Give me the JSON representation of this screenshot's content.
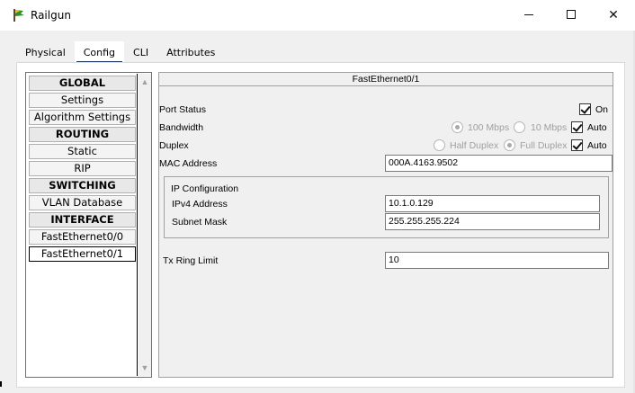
{
  "window": {
    "title": "Railgun",
    "minimize_glyph": "",
    "maximize_glyph": "",
    "close_glyph": "✕"
  },
  "tabs": [
    {
      "label": "Physical"
    },
    {
      "label": "Config"
    },
    {
      "label": "CLI"
    },
    {
      "label": "Attributes"
    }
  ],
  "active_tab": "Config",
  "nav": {
    "items": [
      {
        "label": "GLOBAL",
        "kind": "header"
      },
      {
        "label": "Settings",
        "kind": "item"
      },
      {
        "label": "Algorithm Settings",
        "kind": "item"
      },
      {
        "label": "ROUTING",
        "kind": "header"
      },
      {
        "label": "Static",
        "kind": "item"
      },
      {
        "label": "RIP",
        "kind": "item"
      },
      {
        "label": "SWITCHING",
        "kind": "header"
      },
      {
        "label": "VLAN Database",
        "kind": "item"
      },
      {
        "label": "INTERFACE",
        "kind": "header"
      },
      {
        "label": "FastEthernet0/0",
        "kind": "item"
      },
      {
        "label": "FastEthernet0/1",
        "kind": "item",
        "selected": true
      }
    ]
  },
  "interface": {
    "title": "FastEthernet0/1",
    "port_status_label": "Port Status",
    "port_status_on_label": "On",
    "bandwidth_label": "Bandwidth",
    "bandwidth_100_label": "100 Mbps",
    "bandwidth_10_label": "10 Mbps",
    "bandwidth_auto_label": "Auto",
    "duplex_label": "Duplex",
    "duplex_half_label": "Half Duplex",
    "duplex_full_label": "Full Duplex",
    "duplex_auto_label": "Auto",
    "mac_label": "MAC Address",
    "mac_value": "000A.4163.9502",
    "ip_config_label": "IP Configuration",
    "ipv4_label": "IPv4 Address",
    "ipv4_value": "10.1.0.129",
    "subnet_label": "Subnet Mask",
    "subnet_value": "255.255.255.224",
    "tx_ring_label": "Tx Ring Limit",
    "tx_ring_value": "10"
  }
}
